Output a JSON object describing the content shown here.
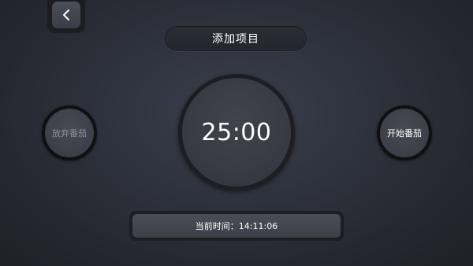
{
  "header": {
    "back_icon": "chevron-left-icon",
    "title": "添加项目"
  },
  "timer": {
    "display": "25:00"
  },
  "controls": {
    "abandon_label": "放弃番茄",
    "start_label": "开始番茄"
  },
  "status": {
    "current_time": "当前时间：14:11:06"
  },
  "colors": {
    "background": "#2f333d",
    "disabled_text": "#8e9098",
    "text": "#ffffff"
  }
}
